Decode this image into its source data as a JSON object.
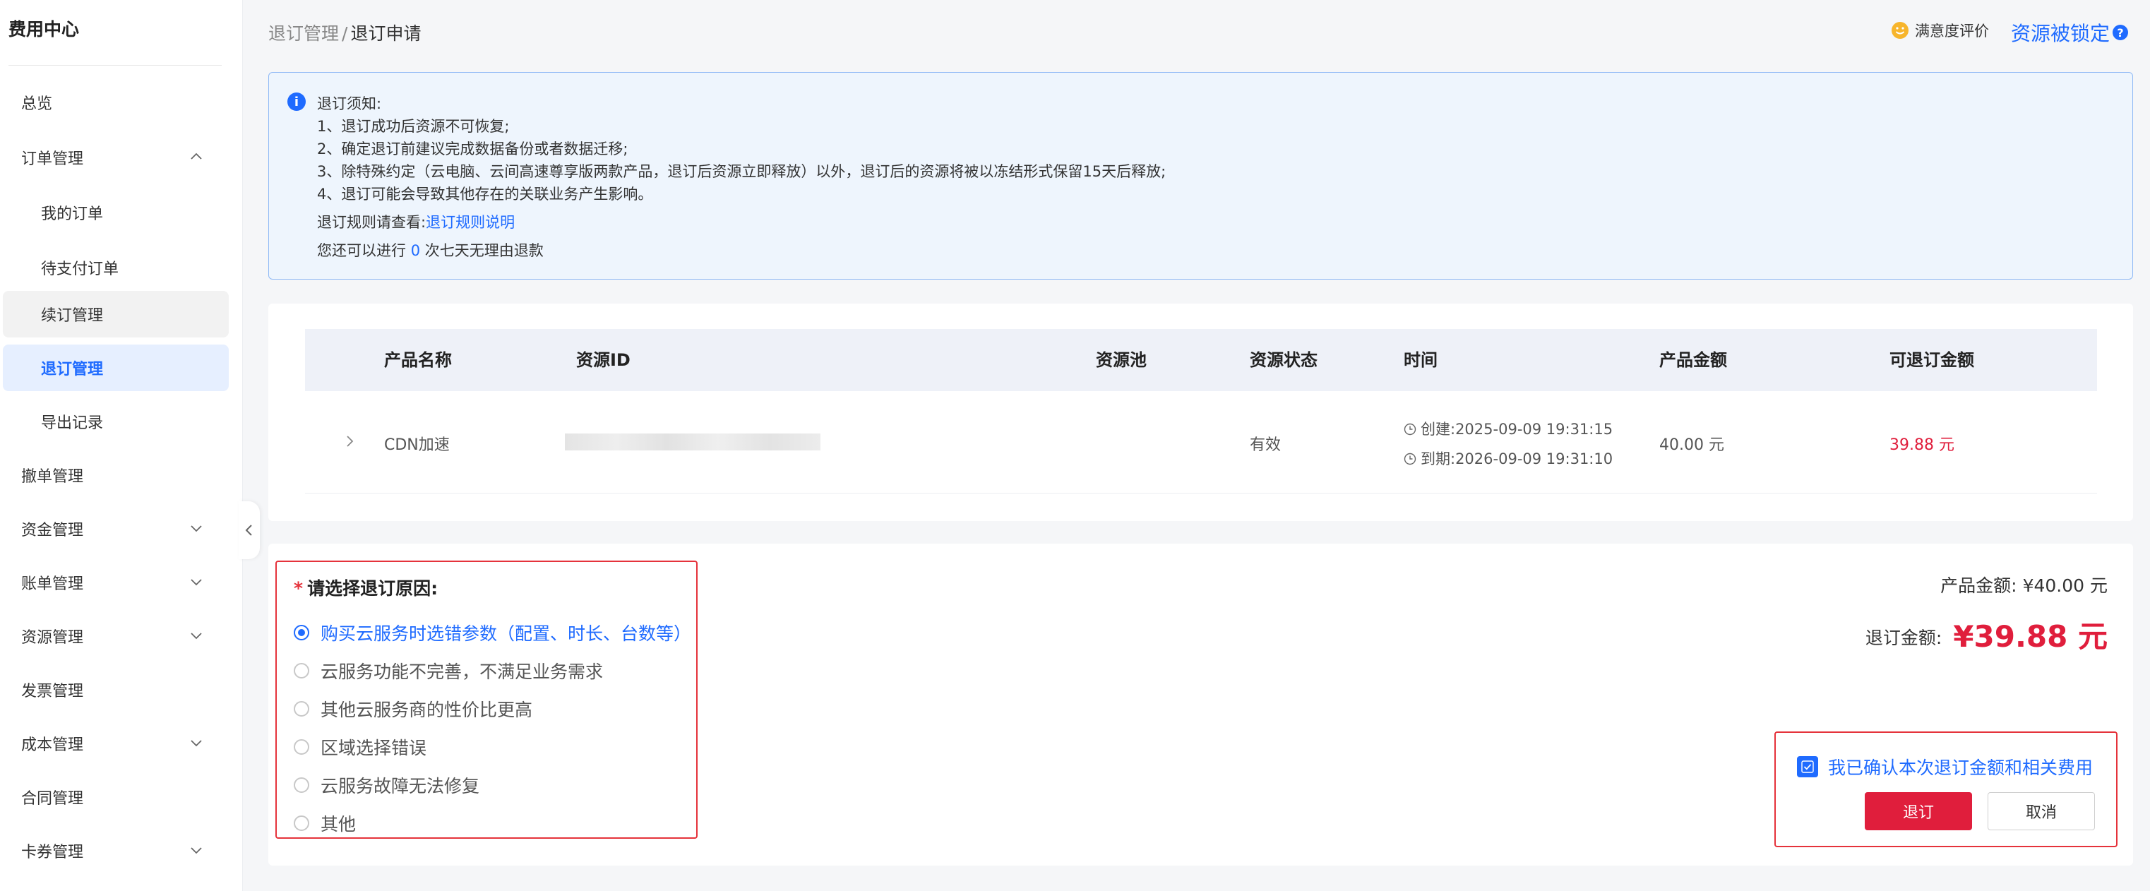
{
  "sidebar": {
    "title": "费用中心",
    "items": [
      {
        "label": "总览"
      },
      {
        "label": "订单管理"
      },
      {
        "label": "我的订单"
      },
      {
        "label": "待支付订单"
      },
      {
        "label": "续订管理"
      },
      {
        "label": "退订管理"
      },
      {
        "label": "导出记录"
      },
      {
        "label": "撤单管理"
      },
      {
        "label": "资金管理"
      },
      {
        "label": "账单管理"
      },
      {
        "label": "资源管理"
      },
      {
        "label": "发票管理"
      },
      {
        "label": "成本管理"
      },
      {
        "label": "合同管理"
      },
      {
        "label": "卡券管理"
      }
    ]
  },
  "breadcrumb": {
    "parent": "退订管理",
    "separator": "/",
    "current": "退订申请"
  },
  "header": {
    "satisfaction": "满意度评价",
    "locked": "资源被锁定",
    "help_icon": "?"
  },
  "notice": {
    "icon": "i",
    "title": "退订须知:",
    "lines": [
      "1、退订成功后资源不可恢复;",
      "2、确定退订前建议完成数据备份或者数据迁移;",
      "3、除特殊约定（云电脑、云间高速尊享版两款产品，退订后资源立即释放）以外，退订后的资源将被以冻结形式保留15天后释放;",
      "4、退订可能会导致其他存在的关联业务产生影响。"
    ],
    "rules_prefix": "退订规则请查看:",
    "rules_link": "退订规则说明",
    "refund_prefix": "您还可以进行",
    "refund_count": "0",
    "refund_suffix": "次七天无理由退款"
  },
  "table": {
    "headers": [
      "产品名称",
      "资源ID",
      "资源池",
      "资源状态",
      "时间",
      "产品金额",
      "可退订金额"
    ],
    "rows": [
      {
        "product": "CDN加速",
        "resource_id": "",
        "pool": "",
        "status": "有效",
        "created": "创建:2025-09-09 19:31:15",
        "expires": "到期:2026-09-09 19:31:10",
        "amount": "40.00 元",
        "refundable": "39.88 元"
      }
    ]
  },
  "reasons": {
    "required_mark": "*",
    "title": "请选择退订原因:",
    "options": [
      "购买云服务时选错参数（配置、时长、台数等）",
      "云服务功能不完善，不满足业务需求",
      "其他云服务商的性价比更高",
      "区域选择错误",
      "云服务故障无法修复",
      "其他"
    ],
    "selected_index": 0
  },
  "summary": {
    "product_amount_label": "产品金额:",
    "product_amount": "¥40.00 元",
    "refund_label": "退订金额:",
    "refund_amount": "¥39.88 元"
  },
  "confirm": {
    "checkbox_label": "我已确认本次退订金额和相关费用",
    "checked": true,
    "submit": "退订",
    "cancel": "取消"
  },
  "colors": {
    "accent": "#1f6bff",
    "danger": "#e01e3c",
    "notice_bg": "#eef5fd"
  }
}
